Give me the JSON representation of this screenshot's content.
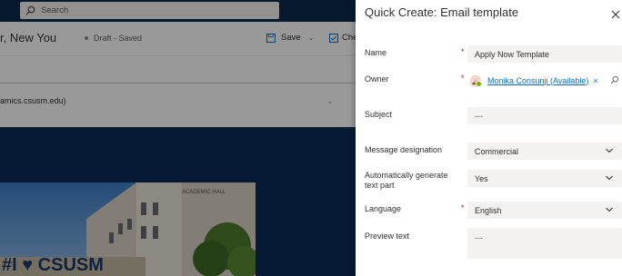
{
  "background_app": {
    "search_placeholder": "Search",
    "record_title": "r, New You",
    "record_status": "Draft - Saved",
    "save_label": "Save",
    "check_label": "Chec",
    "email_fragment": "amics.csusm.edu)",
    "photo_sign": "ACADEMIC HALL",
    "photo_text": "#I ♥ CSUSM"
  },
  "quick_create": {
    "title": "Quick Create: Email template",
    "close_icon": "close-icon",
    "required_mark": "*",
    "fields": {
      "name": {
        "label": "Name",
        "value": "Apply Now Template"
      },
      "owner": {
        "label": "Owner",
        "value": "Monika Consunji (Available)",
        "remove": "×"
      },
      "subject": {
        "label": "Subject",
        "value": "---"
      },
      "message_designation": {
        "label": "Message designation",
        "value": "Commercial"
      },
      "auto_text": {
        "label": "Automatically generate text part",
        "value": "Yes"
      },
      "language": {
        "label": "Language",
        "value": "English"
      },
      "preview_text": {
        "label": "Preview text",
        "value": "---"
      }
    }
  },
  "colors": {
    "link": "#0f6cbd",
    "required": "#a4262c",
    "presence_available": "#6bb700",
    "topbar": "#0c2a4d"
  }
}
